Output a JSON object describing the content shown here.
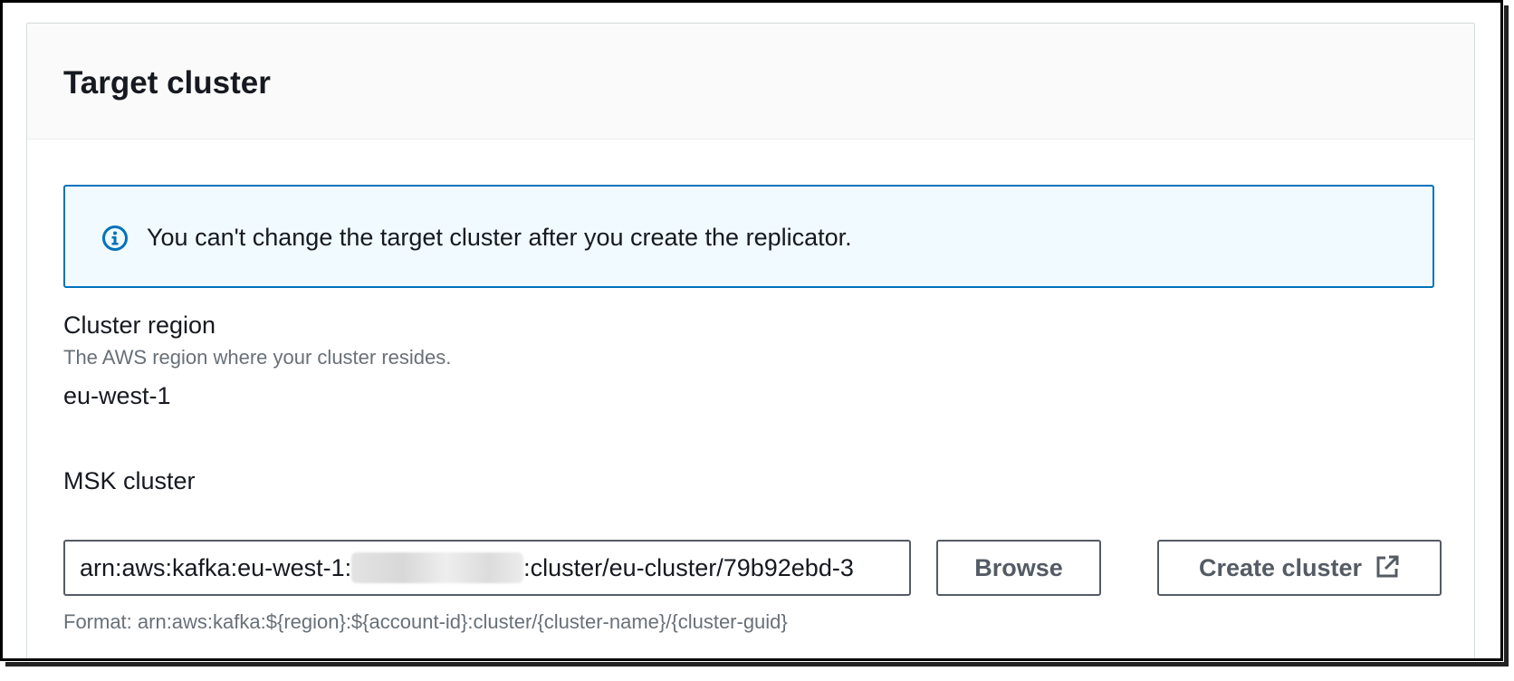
{
  "panel": {
    "title": "Target cluster"
  },
  "alert": {
    "icon": "info-icon",
    "message": "You can't change the target cluster after you create the replicator."
  },
  "cluster_region": {
    "label": "Cluster region",
    "description": "The AWS region where your cluster resides.",
    "value": "eu-west-1"
  },
  "msk_cluster": {
    "label": "MSK cluster",
    "arn_prefix": "arn:aws:kafka:eu-west-1:",
    "arn_suffix": ":cluster/eu-cluster/79b92ebd-3",
    "format_hint": "Format: arn:aws:kafka:${region}:${account-id}:cluster/{cluster-name}/{cluster-guid}",
    "browse_label": "Browse",
    "create_label": "Create cluster",
    "create_icon": "external-link-icon"
  },
  "colors": {
    "alert_border": "#0073bb",
    "alert_background": "#f1faff",
    "text_primary": "#16191f",
    "text_secondary": "#687078",
    "button_text": "#545b64"
  }
}
